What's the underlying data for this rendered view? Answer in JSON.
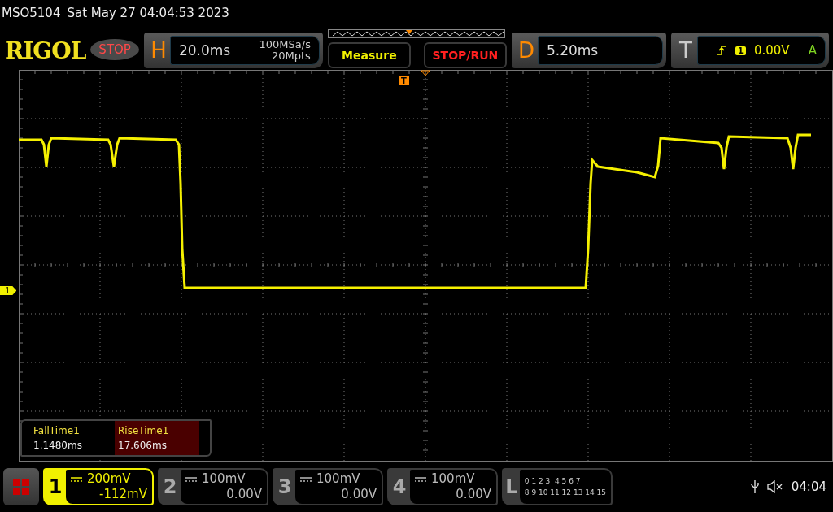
{
  "status_line": {
    "model": "MSO5104",
    "datetime": "Sat May 27 04:04:53 2023"
  },
  "header": {
    "logo": "RIGOL",
    "run_state": "STOP",
    "horizontal": {
      "label": "H",
      "timebase": "20.0ms",
      "sample_rate": "100MSa/s",
      "memory_depth": "20Mpts"
    },
    "buttons": [
      "Measure",
      "STOP/RUN"
    ],
    "delay": {
      "label": "D",
      "value": "5.20ms"
    },
    "trigger": {
      "label": "T",
      "source": "1",
      "level": "0.00V",
      "mode": "A"
    }
  },
  "screen": {
    "channel_marker": "1",
    "trigger_marker": "T"
  },
  "measurements": [
    {
      "name": "FallTime1",
      "value": "1.1480ms",
      "selected": false
    },
    {
      "name": "RiseTime1",
      "value": "17.606ms",
      "selected": true
    }
  ],
  "channels": [
    {
      "number": "1",
      "scale": "200mV",
      "offset": "-112mV",
      "on": true
    },
    {
      "number": "2",
      "scale": "100mV",
      "offset": "0.00V",
      "on": false
    },
    {
      "number": "3",
      "scale": "100mV",
      "offset": "0.00V",
      "on": false
    },
    {
      "number": "4",
      "scale": "100mV",
      "offset": "0.00V",
      "on": false
    }
  ],
  "logic": {
    "label": "L",
    "rows": [
      "0 1 2 3  4 5 6 7",
      "8 9 10 11 12 13 14 15"
    ]
  },
  "status": {
    "time": "04:04"
  }
}
